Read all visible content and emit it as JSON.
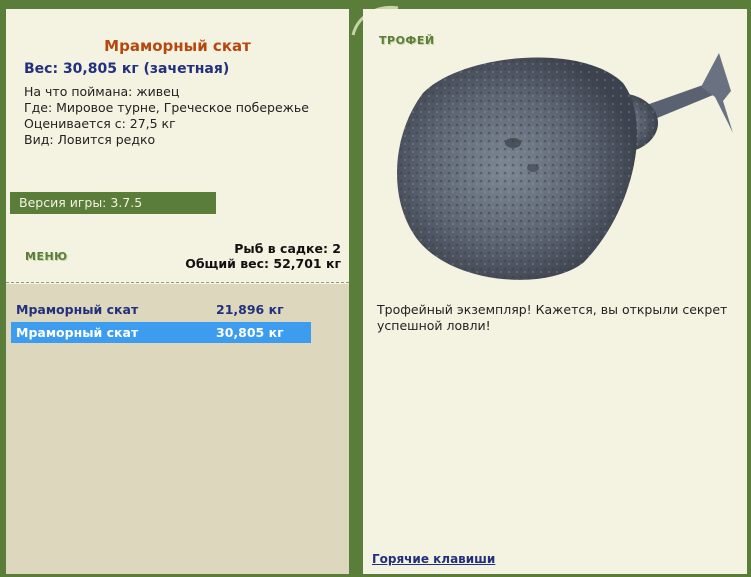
{
  "fish": {
    "name": "Мраморный скат",
    "weight_line": "Вес: 30,805 кг (зачетная)",
    "bait": "На что поймана: живец",
    "location": "Где: Мировое турне, Греческое побережье",
    "rated_from": "Оценивается с: 27,5 кг",
    "kind": "Вид: Ловится редко"
  },
  "version": "Версия игры: 3.7.5",
  "menu_label": "МЕНЮ",
  "stats": {
    "fish_count": "Рыб в садке: 2",
    "total_weight": "Общий вес: 52,701 кг"
  },
  "catch_list": [
    {
      "name": "Мраморный скат",
      "weight": "21,896 кг",
      "selected": false
    },
    {
      "name": "Мраморный скат",
      "weight": "30,805 кг",
      "selected": true
    }
  ],
  "right": {
    "trophy_label": "ТРОФЕЙ",
    "description": "Трофейный экземпляр! Кажется, вы открыли секрет успешной ловли!",
    "hotkeys_link": "Горячие клавиши"
  },
  "colors": {
    "frame": "#5b7d3a",
    "panel": "#f4f2e0",
    "title": "#b5470f",
    "accent_text": "#22307e",
    "selection": "#3c9cf0"
  }
}
